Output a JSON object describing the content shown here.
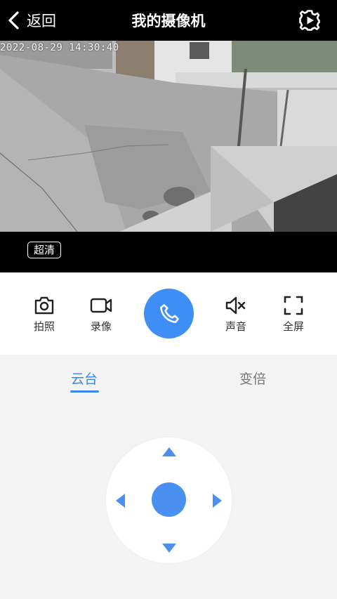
{
  "header": {
    "back_label": "返回",
    "title": "我的摄像机",
    "settings_icon": "gear-play-icon"
  },
  "video": {
    "timestamp": "2022-08-29 14:30:40",
    "quality_label": "超清"
  },
  "controls": {
    "photo_label": "拍照",
    "record_label": "录像",
    "sound_label": "声音",
    "fullscreen_label": "全屏",
    "call_icon": "phone-icon",
    "accent_color": "#3f8ef5"
  },
  "tabs": {
    "ptz_label": "云台",
    "zoom_label": "变倍",
    "active": "云台"
  }
}
